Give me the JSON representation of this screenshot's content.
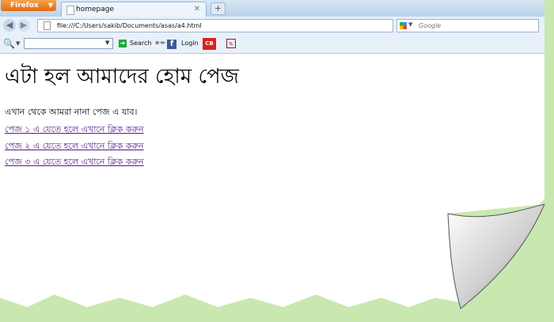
{
  "browser": {
    "menu_button": "Firefox",
    "tab_title": "homepage",
    "new_tab_symbol": "+",
    "url": "file:///C:/Users/sakib/Documents/asas/a4.html",
    "search_placeholder": "Google"
  },
  "toolbar": {
    "search_label": "Search",
    "login_label": "Login",
    "cb_label": "CB"
  },
  "page": {
    "heading": "এটা হল আমাদের হোম পেজ",
    "intro": "এখান থেকে আমরা নানা পেজ এ যাব।",
    "links": [
      "পেজ ১ এ যেতে হলে এখানে ক্লিক করুন",
      "পেজ ২ এ যেতে হলে এখানে ক্লিক করুন",
      "পেজ ৩ এ যেতে হলে এখানে ক্লিক করুন"
    ]
  },
  "colors": {
    "background": "#c9e8b0",
    "link_visited": "#551a8b",
    "firefox_orange": "#e8791f"
  }
}
